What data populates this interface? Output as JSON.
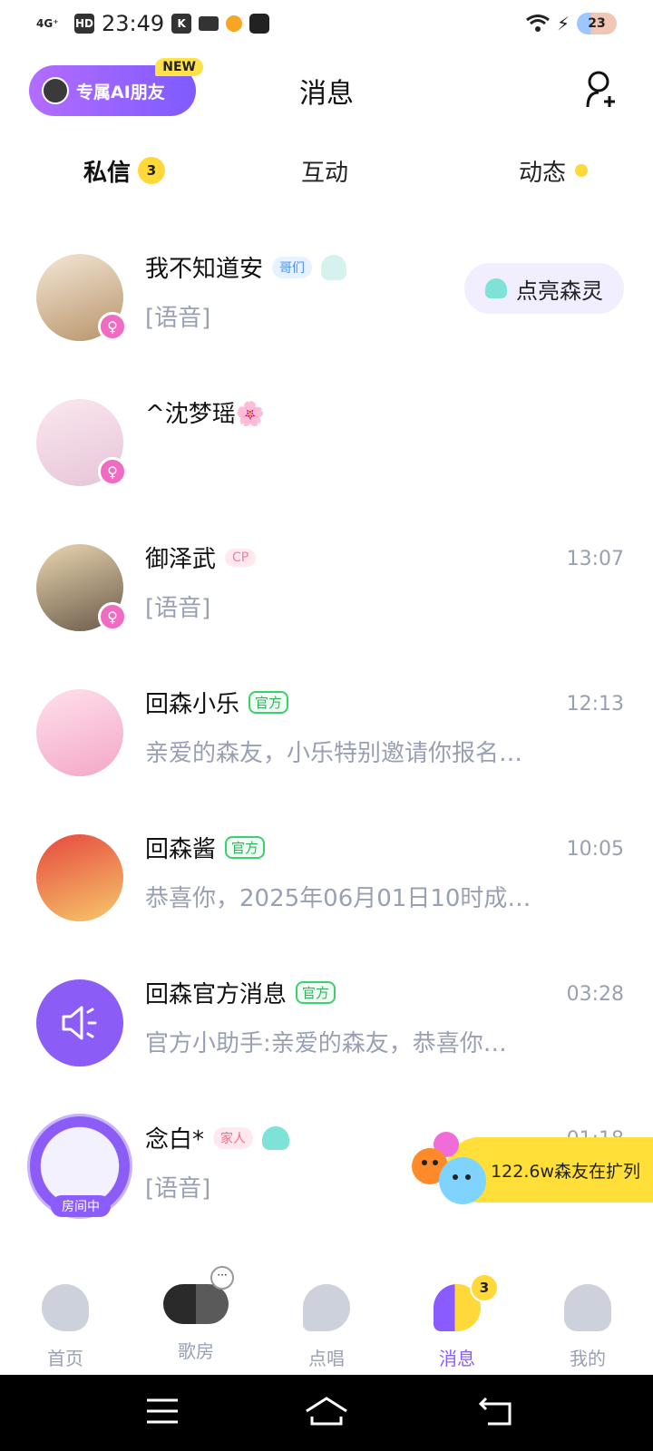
{
  "status_bar": {
    "signal": "4G⁺",
    "hd": "HD",
    "time": "23:49",
    "battery": "23"
  },
  "header": {
    "ai_pill_label": "专属AI朋友",
    "new_tag": "NEW",
    "title": "消息"
  },
  "tabs": [
    {
      "label": "私信",
      "badge": "3"
    },
    {
      "label": "互动"
    },
    {
      "label": "动态"
    }
  ],
  "conversations": [
    {
      "name": "我不知道安",
      "tag": "哥们",
      "preview": "[语音]",
      "time": "",
      "action": "点亮森灵"
    },
    {
      "name": "^沈梦瑶🌸",
      "tag": "",
      "preview": "",
      "time": ""
    },
    {
      "name": "御泽武",
      "tag": "CP",
      "preview": "[语音]",
      "time": "13:07"
    },
    {
      "name": "回森小乐",
      "tag": "官方",
      "preview": "亲爱的森友，小乐特别邀请你报名…",
      "time": "12:13"
    },
    {
      "name": "回森酱",
      "tag": "官方",
      "preview": "恭喜你，2025年06月01日10时成…",
      "time": "10:05"
    },
    {
      "name": "回森官方消息",
      "tag": "官方",
      "preview": "官方小助手:亲爱的森友，恭喜你…",
      "time": "03:28"
    },
    {
      "name": "念白*",
      "tag": "家人",
      "preview": "[语音]",
      "time": "01:18",
      "status": "房间中"
    }
  ],
  "banner": {
    "text": "122.6w森友在扩列"
  },
  "bottom_nav": [
    {
      "label": "首页"
    },
    {
      "label": "歌房"
    },
    {
      "label": "点唱"
    },
    {
      "label": "消息",
      "badge": "3"
    },
    {
      "label": "我的"
    }
  ],
  "colors": {
    "accent_purple": "#8a5cff",
    "accent_yellow": "#ffd83a",
    "official_green": "#2bb55b",
    "gender_pink": "#f06cc3",
    "secondary_text": "#9aa0b4"
  }
}
